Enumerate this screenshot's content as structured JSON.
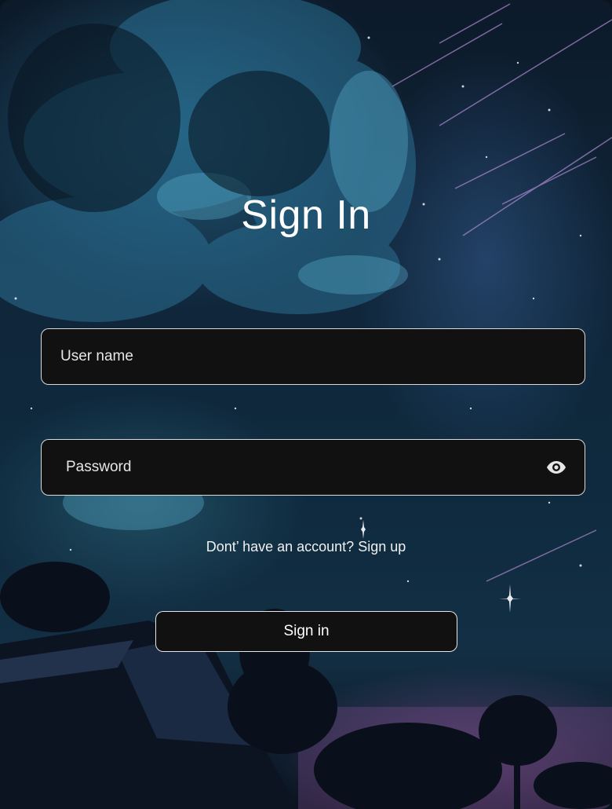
{
  "page": {
    "title": "Sign In"
  },
  "form": {
    "username": {
      "placeholder": "User name",
      "value": ""
    },
    "password": {
      "placeholder": "Password",
      "value": ""
    },
    "password_toggle_icon": "eye-icon",
    "signup_prompt": "Dont’ have an account?",
    "signup_link": "Sign up",
    "submit_label": "Sign in"
  },
  "colors": {
    "field_bg": "#111111",
    "field_border": "#ffffff",
    "text": "#ffffff",
    "background_base": "#0f2a3e",
    "sky_accent": "#3287af",
    "horizon_glow": "#965aa0"
  }
}
